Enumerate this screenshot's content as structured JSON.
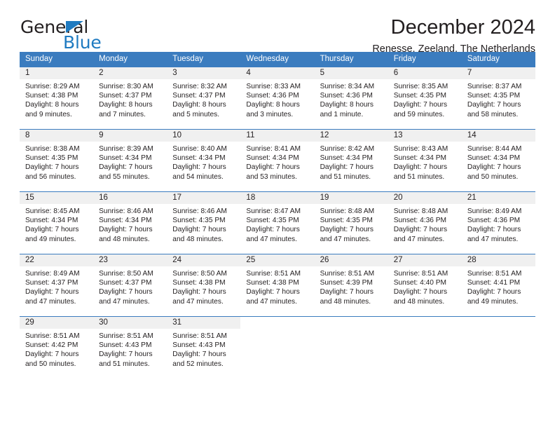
{
  "brand": {
    "name_part1": "General",
    "name_part2": "Blue",
    "triangle_color": "#1f7bc1",
    "text_color": "#231f20"
  },
  "header": {
    "title": "December 2024",
    "subtitle": "Renesse, Zeeland, The Netherlands"
  },
  "theme": {
    "header_blue": "#3b7cbf",
    "daynum_bg": "#f0f0f0",
    "text": "#231f20"
  },
  "weekdays": [
    "Sunday",
    "Monday",
    "Tuesday",
    "Wednesday",
    "Thursday",
    "Friday",
    "Saturday"
  ],
  "weeks": [
    [
      {
        "day": "1",
        "sunrise": "Sunrise: 8:29 AM",
        "sunset": "Sunset: 4:38 PM",
        "daylight1": "Daylight: 8 hours",
        "daylight2": "and 9 minutes."
      },
      {
        "day": "2",
        "sunrise": "Sunrise: 8:30 AM",
        "sunset": "Sunset: 4:37 PM",
        "daylight1": "Daylight: 8 hours",
        "daylight2": "and 7 minutes."
      },
      {
        "day": "3",
        "sunrise": "Sunrise: 8:32 AM",
        "sunset": "Sunset: 4:37 PM",
        "daylight1": "Daylight: 8 hours",
        "daylight2": "and 5 minutes."
      },
      {
        "day": "4",
        "sunrise": "Sunrise: 8:33 AM",
        "sunset": "Sunset: 4:36 PM",
        "daylight1": "Daylight: 8 hours",
        "daylight2": "and 3 minutes."
      },
      {
        "day": "5",
        "sunrise": "Sunrise: 8:34 AM",
        "sunset": "Sunset: 4:36 PM",
        "daylight1": "Daylight: 8 hours",
        "daylight2": "and 1 minute."
      },
      {
        "day": "6",
        "sunrise": "Sunrise: 8:35 AM",
        "sunset": "Sunset: 4:35 PM",
        "daylight1": "Daylight: 7 hours",
        "daylight2": "and 59 minutes."
      },
      {
        "day": "7",
        "sunrise": "Sunrise: 8:37 AM",
        "sunset": "Sunset: 4:35 PM",
        "daylight1": "Daylight: 7 hours",
        "daylight2": "and 58 minutes."
      }
    ],
    [
      {
        "day": "8",
        "sunrise": "Sunrise: 8:38 AM",
        "sunset": "Sunset: 4:35 PM",
        "daylight1": "Daylight: 7 hours",
        "daylight2": "and 56 minutes."
      },
      {
        "day": "9",
        "sunrise": "Sunrise: 8:39 AM",
        "sunset": "Sunset: 4:34 PM",
        "daylight1": "Daylight: 7 hours",
        "daylight2": "and 55 minutes."
      },
      {
        "day": "10",
        "sunrise": "Sunrise: 8:40 AM",
        "sunset": "Sunset: 4:34 PM",
        "daylight1": "Daylight: 7 hours",
        "daylight2": "and 54 minutes."
      },
      {
        "day": "11",
        "sunrise": "Sunrise: 8:41 AM",
        "sunset": "Sunset: 4:34 PM",
        "daylight1": "Daylight: 7 hours",
        "daylight2": "and 53 minutes."
      },
      {
        "day": "12",
        "sunrise": "Sunrise: 8:42 AM",
        "sunset": "Sunset: 4:34 PM",
        "daylight1": "Daylight: 7 hours",
        "daylight2": "and 51 minutes."
      },
      {
        "day": "13",
        "sunrise": "Sunrise: 8:43 AM",
        "sunset": "Sunset: 4:34 PM",
        "daylight1": "Daylight: 7 hours",
        "daylight2": "and 51 minutes."
      },
      {
        "day": "14",
        "sunrise": "Sunrise: 8:44 AM",
        "sunset": "Sunset: 4:34 PM",
        "daylight1": "Daylight: 7 hours",
        "daylight2": "and 50 minutes."
      }
    ],
    [
      {
        "day": "15",
        "sunrise": "Sunrise: 8:45 AM",
        "sunset": "Sunset: 4:34 PM",
        "daylight1": "Daylight: 7 hours",
        "daylight2": "and 49 minutes."
      },
      {
        "day": "16",
        "sunrise": "Sunrise: 8:46 AM",
        "sunset": "Sunset: 4:34 PM",
        "daylight1": "Daylight: 7 hours",
        "daylight2": "and 48 minutes."
      },
      {
        "day": "17",
        "sunrise": "Sunrise: 8:46 AM",
        "sunset": "Sunset: 4:35 PM",
        "daylight1": "Daylight: 7 hours",
        "daylight2": "and 48 minutes."
      },
      {
        "day": "18",
        "sunrise": "Sunrise: 8:47 AM",
        "sunset": "Sunset: 4:35 PM",
        "daylight1": "Daylight: 7 hours",
        "daylight2": "and 47 minutes."
      },
      {
        "day": "19",
        "sunrise": "Sunrise: 8:48 AM",
        "sunset": "Sunset: 4:35 PM",
        "daylight1": "Daylight: 7 hours",
        "daylight2": "and 47 minutes."
      },
      {
        "day": "20",
        "sunrise": "Sunrise: 8:48 AM",
        "sunset": "Sunset: 4:36 PM",
        "daylight1": "Daylight: 7 hours",
        "daylight2": "and 47 minutes."
      },
      {
        "day": "21",
        "sunrise": "Sunrise: 8:49 AM",
        "sunset": "Sunset: 4:36 PM",
        "daylight1": "Daylight: 7 hours",
        "daylight2": "and 47 minutes."
      }
    ],
    [
      {
        "day": "22",
        "sunrise": "Sunrise: 8:49 AM",
        "sunset": "Sunset: 4:37 PM",
        "daylight1": "Daylight: 7 hours",
        "daylight2": "and 47 minutes."
      },
      {
        "day": "23",
        "sunrise": "Sunrise: 8:50 AM",
        "sunset": "Sunset: 4:37 PM",
        "daylight1": "Daylight: 7 hours",
        "daylight2": "and 47 minutes."
      },
      {
        "day": "24",
        "sunrise": "Sunrise: 8:50 AM",
        "sunset": "Sunset: 4:38 PM",
        "daylight1": "Daylight: 7 hours",
        "daylight2": "and 47 minutes."
      },
      {
        "day": "25",
        "sunrise": "Sunrise: 8:51 AM",
        "sunset": "Sunset: 4:38 PM",
        "daylight1": "Daylight: 7 hours",
        "daylight2": "and 47 minutes."
      },
      {
        "day": "26",
        "sunrise": "Sunrise: 8:51 AM",
        "sunset": "Sunset: 4:39 PM",
        "daylight1": "Daylight: 7 hours",
        "daylight2": "and 48 minutes."
      },
      {
        "day": "27",
        "sunrise": "Sunrise: 8:51 AM",
        "sunset": "Sunset: 4:40 PM",
        "daylight1": "Daylight: 7 hours",
        "daylight2": "and 48 minutes."
      },
      {
        "day": "28",
        "sunrise": "Sunrise: 8:51 AM",
        "sunset": "Sunset: 4:41 PM",
        "daylight1": "Daylight: 7 hours",
        "daylight2": "and 49 minutes."
      }
    ],
    [
      {
        "day": "29",
        "sunrise": "Sunrise: 8:51 AM",
        "sunset": "Sunset: 4:42 PM",
        "daylight1": "Daylight: 7 hours",
        "daylight2": "and 50 minutes."
      },
      {
        "day": "30",
        "sunrise": "Sunrise: 8:51 AM",
        "sunset": "Sunset: 4:43 PM",
        "daylight1": "Daylight: 7 hours",
        "daylight2": "and 51 minutes."
      },
      {
        "day": "31",
        "sunrise": "Sunrise: 8:51 AM",
        "sunset": "Sunset: 4:43 PM",
        "daylight1": "Daylight: 7 hours",
        "daylight2": "and 52 minutes."
      },
      {
        "day": "",
        "sunrise": "",
        "sunset": "",
        "daylight1": "",
        "daylight2": ""
      },
      {
        "day": "",
        "sunrise": "",
        "sunset": "",
        "daylight1": "",
        "daylight2": ""
      },
      {
        "day": "",
        "sunrise": "",
        "sunset": "",
        "daylight1": "",
        "daylight2": ""
      },
      {
        "day": "",
        "sunrise": "",
        "sunset": "",
        "daylight1": "",
        "daylight2": ""
      }
    ]
  ]
}
